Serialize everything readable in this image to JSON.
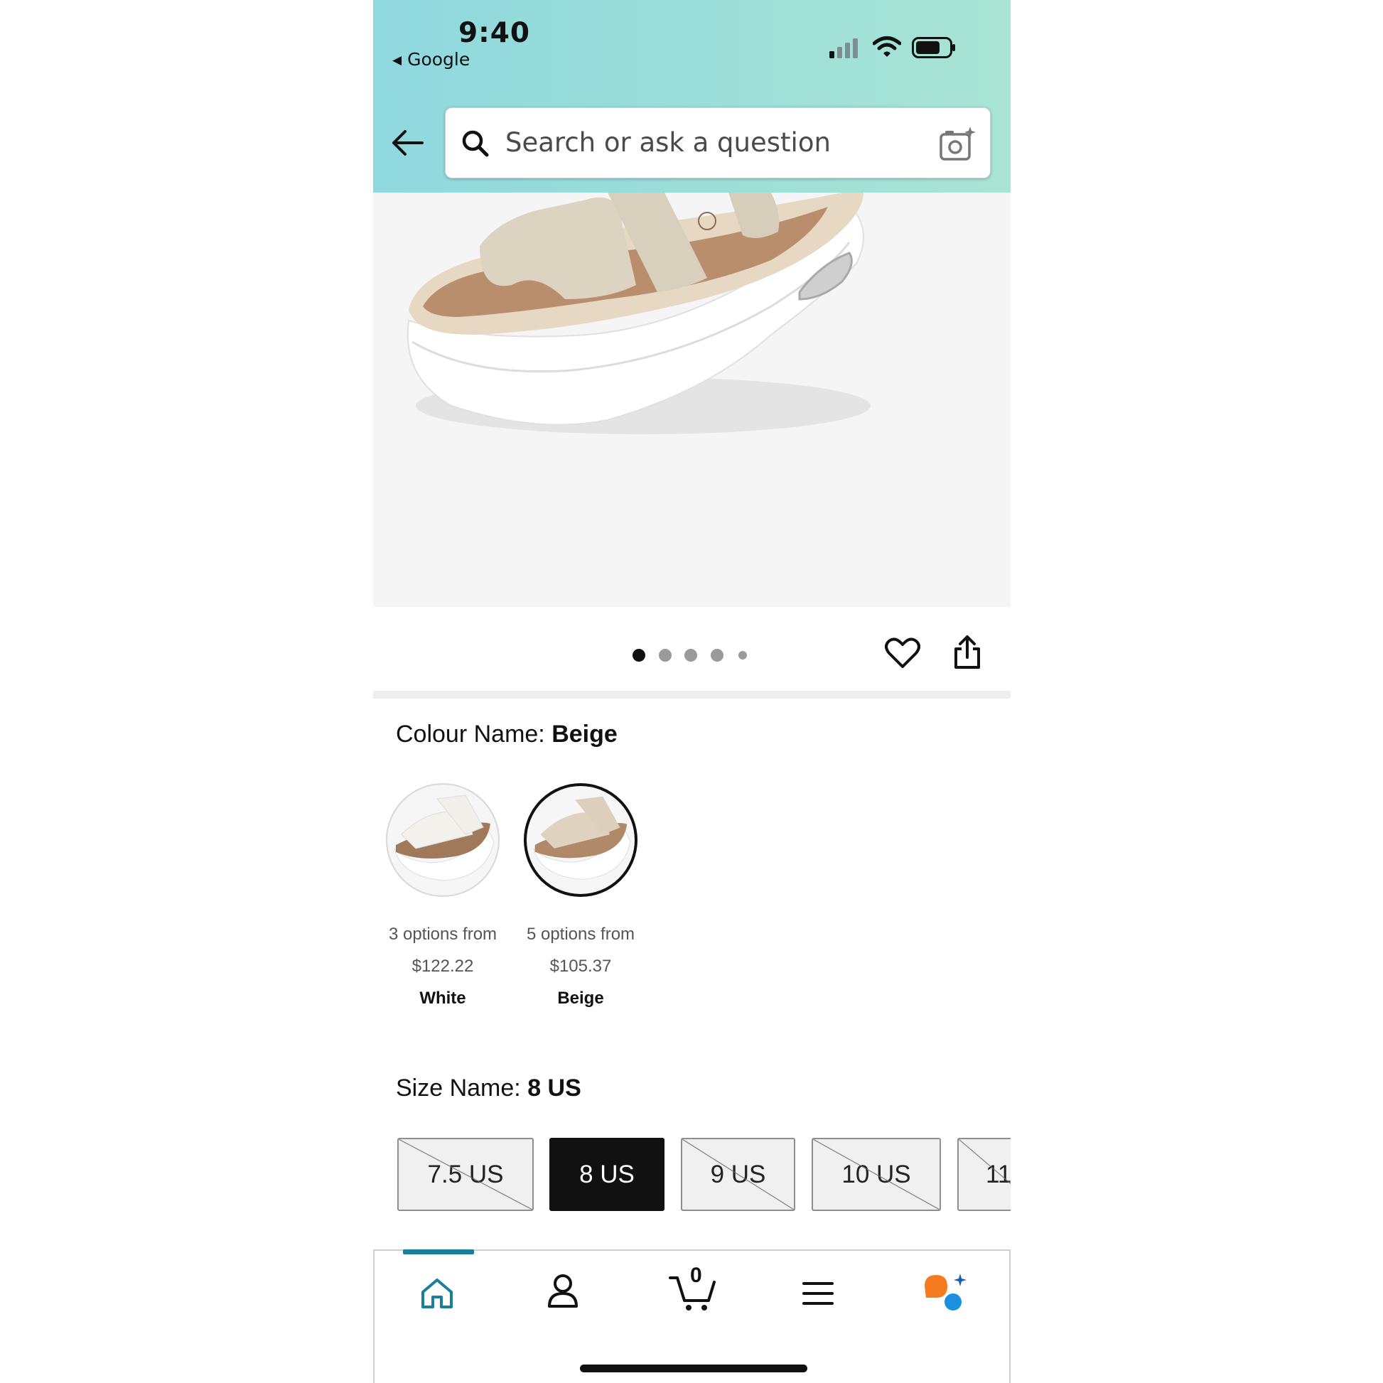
{
  "status_bar": {
    "time": "9:40",
    "back_app": "Google"
  },
  "search": {
    "placeholder": "Search or ask a question"
  },
  "carousel": {
    "total": 5,
    "active_index": 0
  },
  "colour": {
    "label": "Colour Name:",
    "selected": "Beige",
    "options": [
      {
        "options_text": "3 options from",
        "price": "$122.22",
        "name": "White"
      },
      {
        "options_text": "5 options from",
        "price": "$105.37",
        "name": "Beige"
      }
    ]
  },
  "size": {
    "label": "Size Name:",
    "selected": "8 US",
    "options": [
      "7.5 US",
      "8 US",
      "9 US",
      "10 US",
      "11"
    ]
  },
  "bottom_nav": {
    "cart_count": "0",
    "accent": "#1a7f9a"
  },
  "colors": {
    "header_gradient_start": "#8fd8df",
    "header_gradient_end": "#a8e4d3"
  }
}
